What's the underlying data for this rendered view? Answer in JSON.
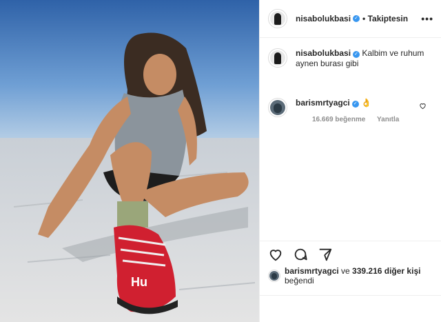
{
  "post": {
    "username": "nisabolukbasi",
    "follow_state": "Takiptesin",
    "more_label": "•••",
    "caption_text": "Kalbim ve ruhum aynen burası gibi",
    "photo_text": "Hu"
  },
  "comment": {
    "username": "barismrtyagci",
    "emoji": "👌",
    "likes": "16.669 beğenme",
    "reply": "Yanıtla"
  },
  "likes": {
    "username": "barismrtyagci",
    "connector": " ve ",
    "count": "339.216 diğer kişi",
    "suffix": " beğendi"
  },
  "icons": [
    "heart-icon",
    "comment-icon",
    "share-icon",
    "verified-icon",
    "more-icon"
  ]
}
